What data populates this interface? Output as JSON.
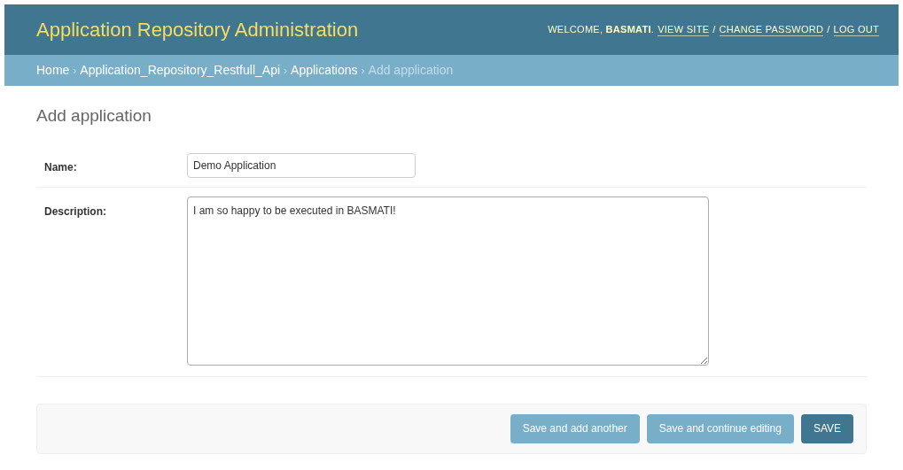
{
  "header": {
    "title": "Application Repository Administration",
    "welcome": "WELCOME, **BASMATI**.",
    "links": [
      {
        "kind": "link",
        "label": "VIEW SITE"
      },
      {
        "kind": "separator",
        "label": "/"
      },
      {
        "kind": "link",
        "label": "CHANGE PASSWORD"
      },
      {
        "kind": "separator",
        "label": "/"
      },
      {
        "kind": "link",
        "label": "LOG OUT"
      }
    ]
  },
  "breadcrumbs": [
    {
      "kind": "link",
      "label": "Home"
    },
    {
      "kind": "separator",
      "label": "›"
    },
    {
      "kind": "link",
      "label": "Application_Repository_Restfull_Api"
    },
    {
      "kind": "separator",
      "label": "›"
    },
    {
      "kind": "link",
      "label": "Applications"
    },
    {
      "kind": "separator",
      "label": "›"
    },
    {
      "kind": "current",
      "label": "Add application"
    }
  ],
  "page_title": "Add application",
  "fields": [
    {
      "kind": "text",
      "label": "Name:",
      "value": "Demo Application"
    },
    {
      "kind": "textarea",
      "label": "Description:",
      "value": "I am so happy to be executed in BASMATI!"
    }
  ],
  "buttons": [
    {
      "kind": "secondary",
      "label": "Save and add another"
    },
    {
      "kind": "secondary",
      "label": "Save and continue editing"
    },
    {
      "kind": "default",
      "label": "SAVE"
    }
  ]
}
